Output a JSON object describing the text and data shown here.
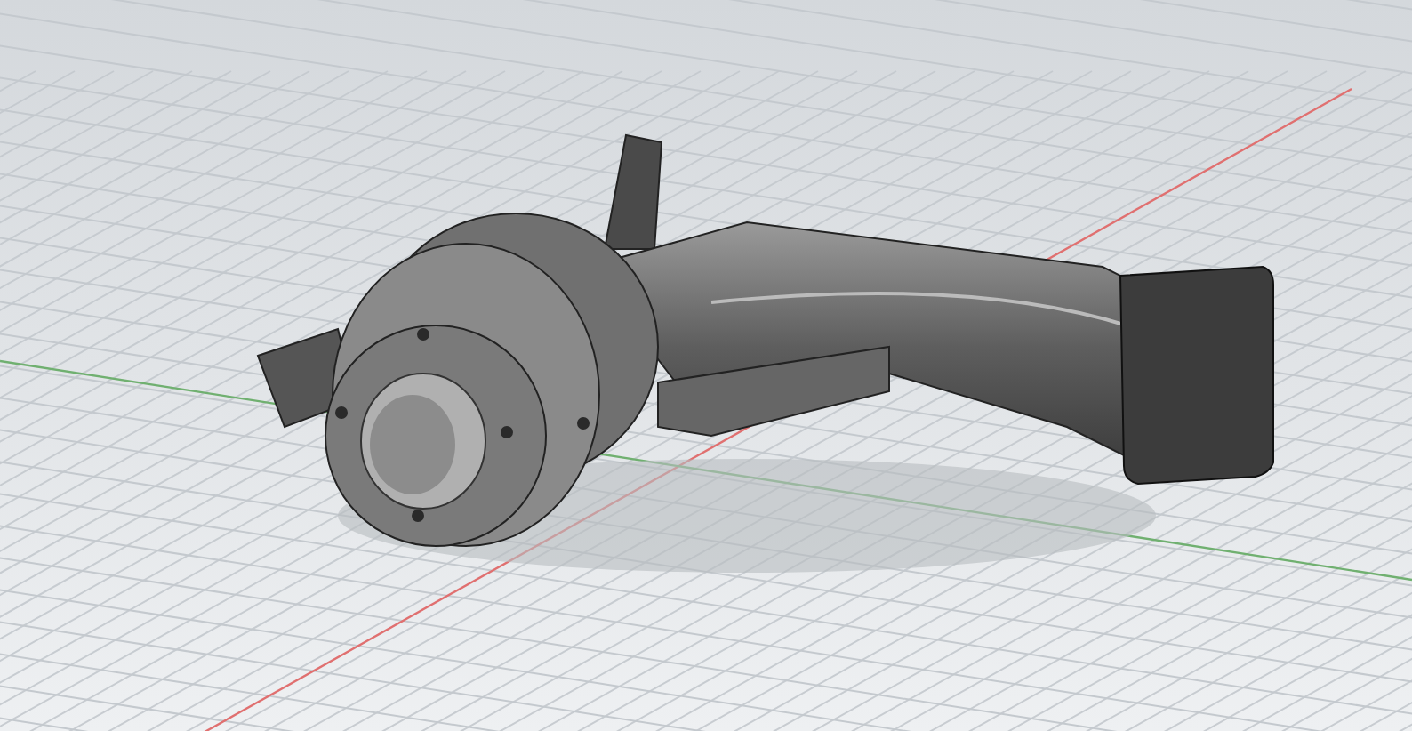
{
  "viewport": {
    "axes": [
      {
        "color": "#e07070"
      },
      {
        "color": "#70b070"
      }
    ]
  }
}
